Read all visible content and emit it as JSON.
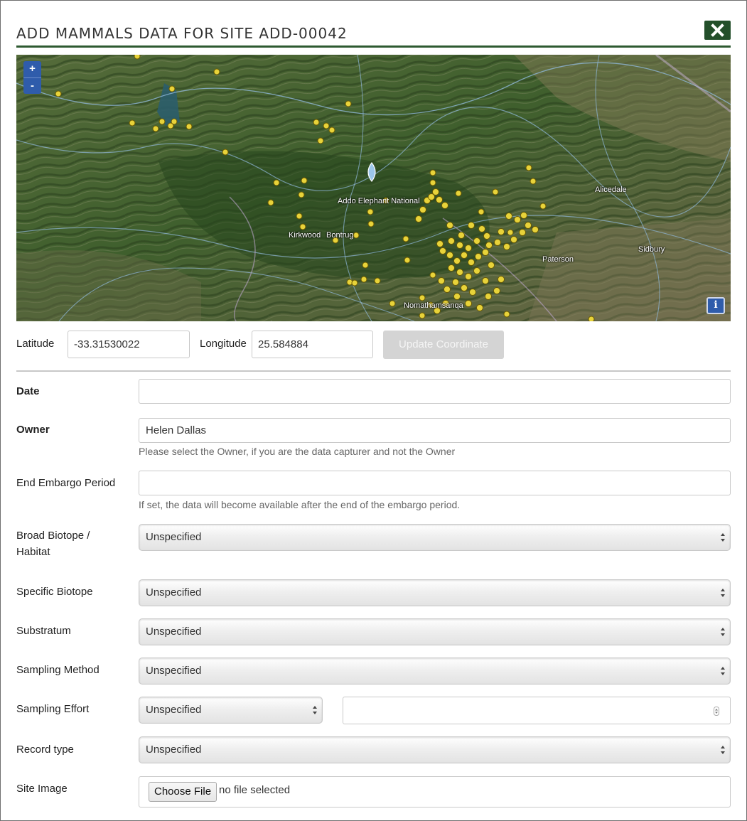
{
  "dialog": {
    "title": "ADD MAMMALS DATA FOR SITE ADD-00042"
  },
  "map": {
    "zoom_in": "+",
    "zoom_out": "-",
    "info": "i",
    "labels": [
      "Addo Elephant National",
      "Kirkwood",
      "Bontrug",
      "Paterson",
      "Sidbury",
      "Alicedale",
      "Nomathamsanqa"
    ],
    "marker_color": "#e8d33a"
  },
  "coordinates": {
    "latitude_label": "Latitude",
    "latitude_value": "-33.31530022",
    "longitude_label": "Longitude",
    "longitude_value": "25.584884",
    "update_button": "Update Coordinate"
  },
  "form": {
    "date": {
      "label": "Date",
      "value": ""
    },
    "owner": {
      "label": "Owner",
      "value": "Helen Dallas",
      "help": "Please select the Owner, if you are the data capturer and not the Owner"
    },
    "embargo": {
      "label": "End Embargo Period",
      "value": "",
      "help": "If set, the data will become available after the end of the embargo period."
    },
    "broad_biotope": {
      "label_line1": "Broad Biotope /",
      "label_line2": "Habitat",
      "value": "Unspecified"
    },
    "specific_biotope": {
      "label": "Specific Biotope",
      "value": "Unspecified"
    },
    "substratum": {
      "label": "Substratum",
      "value": "Unspecified"
    },
    "sampling_method": {
      "label": "Sampling Method",
      "value": "Unspecified"
    },
    "sampling_effort": {
      "label": "Sampling Effort",
      "value": "Unspecified",
      "amount": ""
    },
    "record_type": {
      "label": "Record type",
      "value": "Unspecified"
    },
    "site_image": {
      "label": "Site Image",
      "button": "Choose File",
      "status": "no file selected"
    }
  },
  "colors": {
    "accent": "#234f2a",
    "zoom_control": "#2f5cab"
  }
}
